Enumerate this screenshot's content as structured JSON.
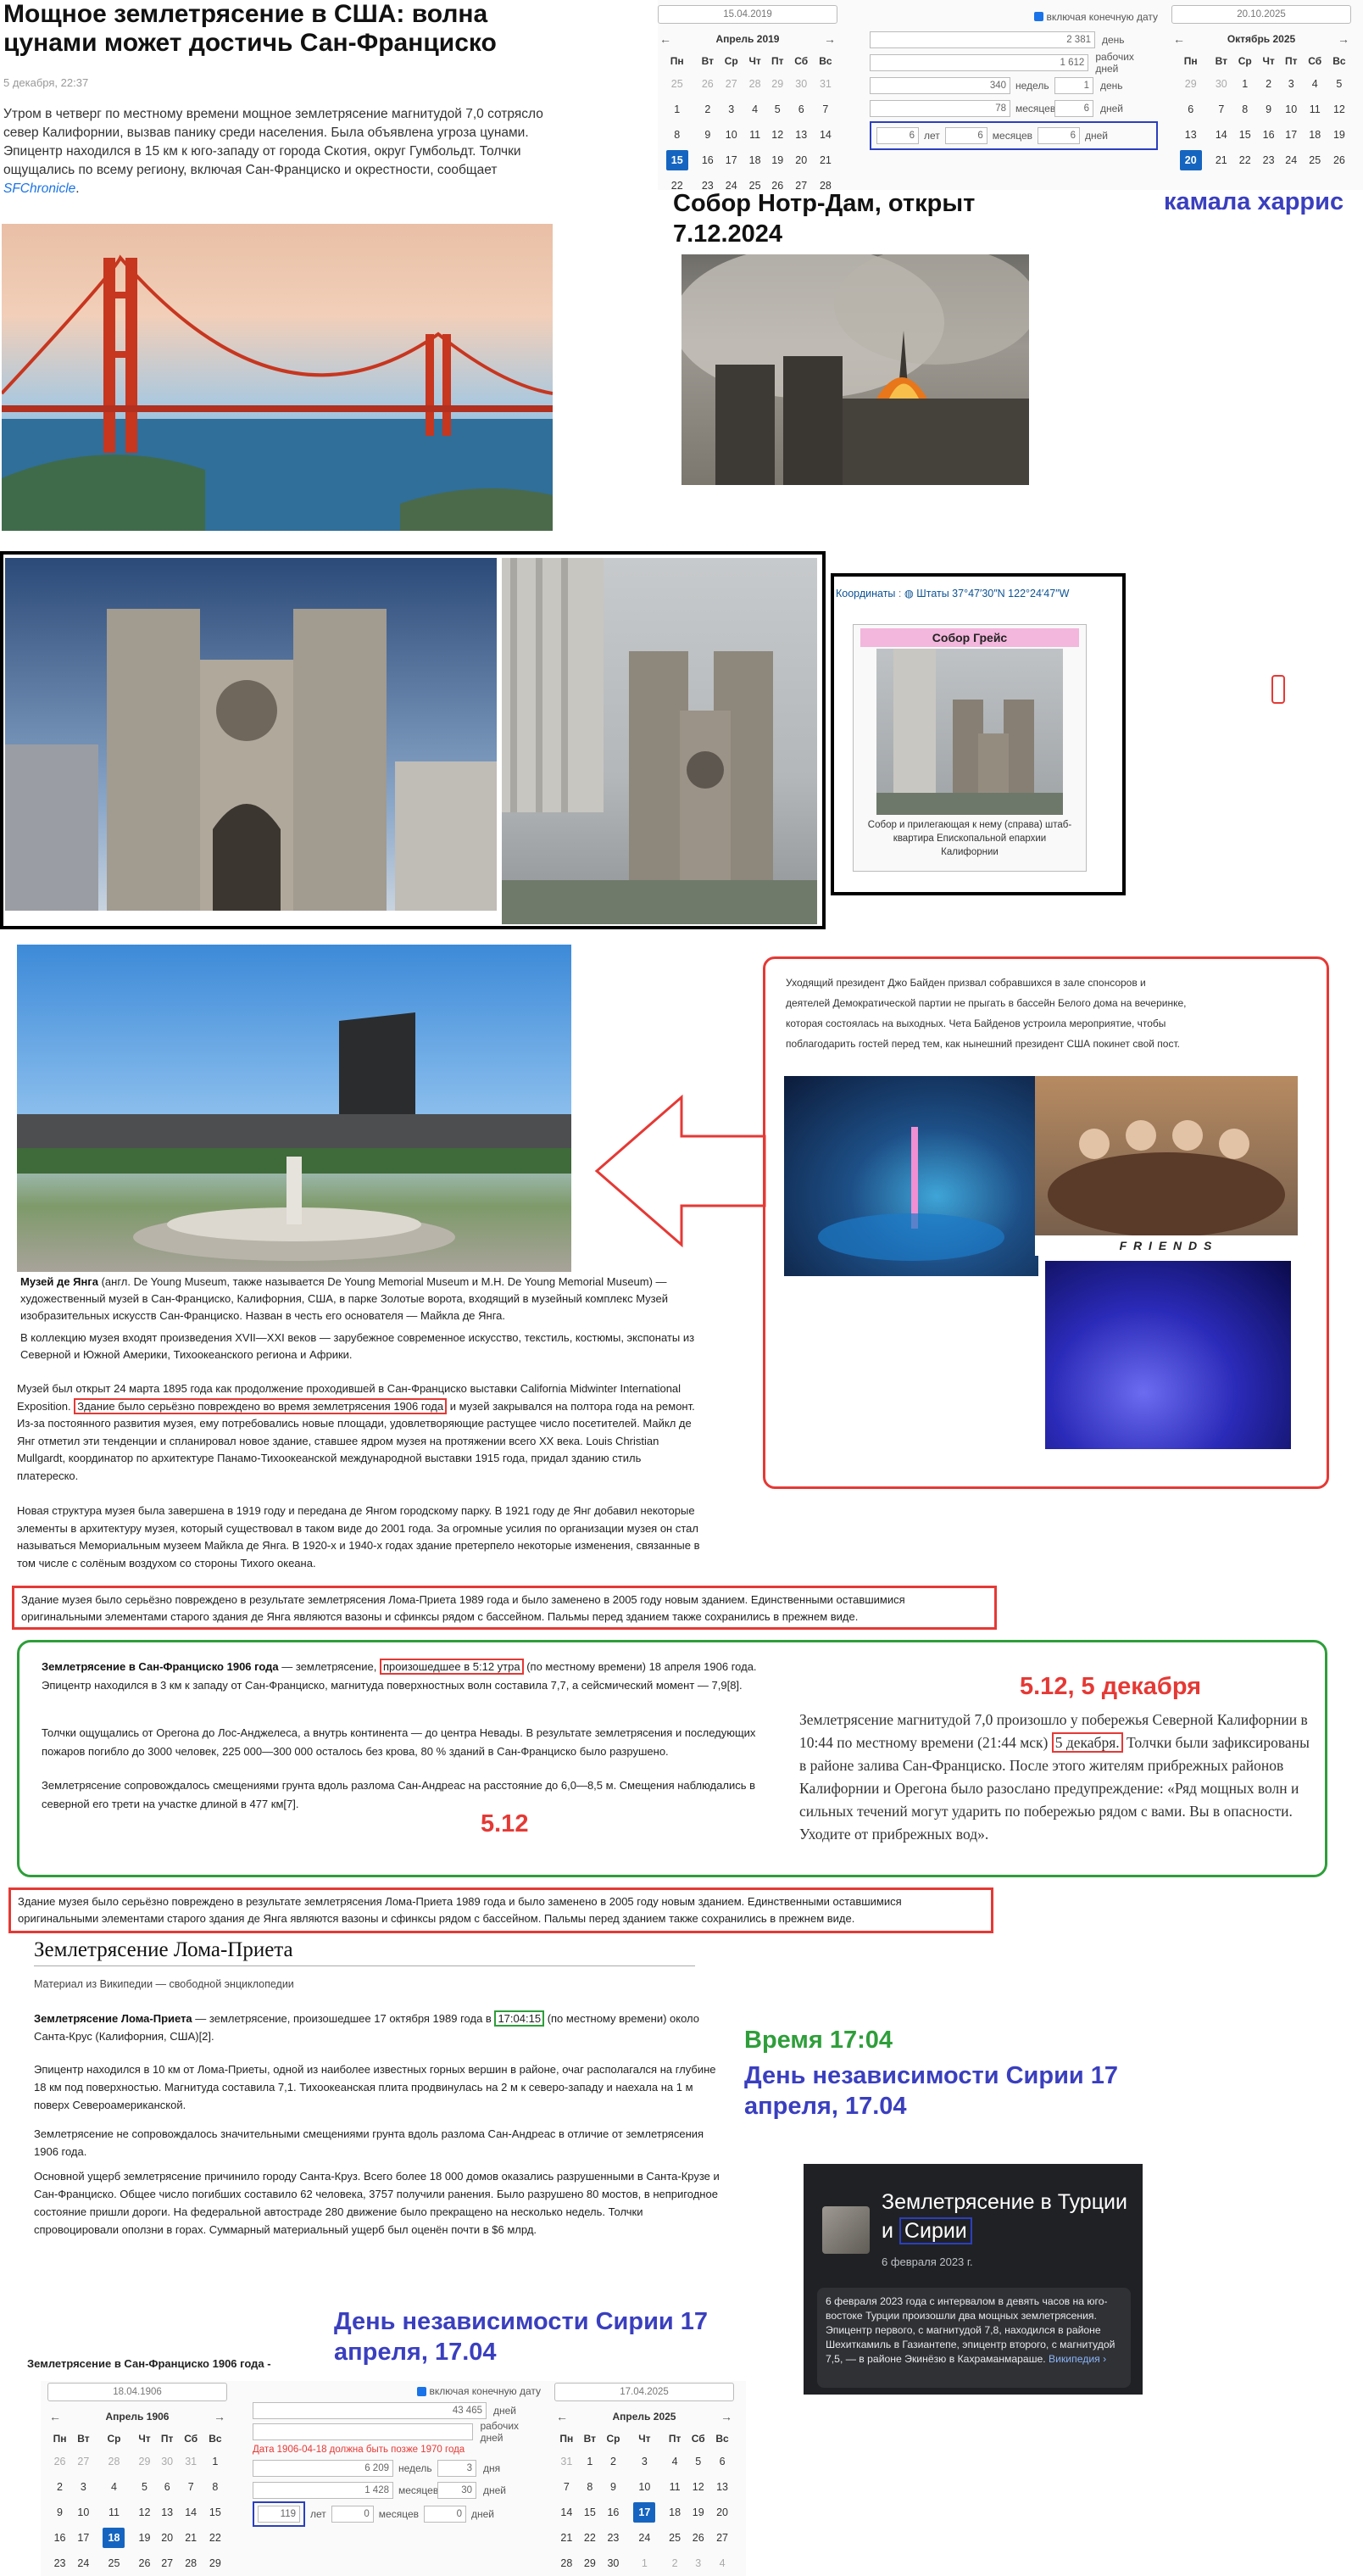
{
  "news": {
    "title": "Мощное землетрясение в США: волна цунами может достичь Сан-Франциско",
    "date": "5 декабря, 22:37",
    "body": "Утром в четверг по местному времени мощное землетрясение магнитудой 7,0 сотрясло север Калифорнии, вызвав панику среди населения. Была объявлена угроза цунами. Эпицентр находился в 15 км к юго-западу от города Скотия, округ Гумбольдт. Толчки ощущались по всему региону, включая Сан-Франциско и окрестности, сообщает",
    "source": "SFChronicle",
    "tail": "."
  },
  "calc_top": {
    "start_date": "15.04.2019",
    "end_date": "20.10.2025",
    "include_end": "включая конечную дату",
    "left_month": "Апрель 2019",
    "right_month": "Октябрь 2025",
    "weekdays": [
      "Пн",
      "Вт",
      "Ср",
      "Чт",
      "Пт",
      "Сб",
      "Вс"
    ],
    "left_rows": [
      [
        "25",
        "26",
        "27",
        "28",
        "29",
        "30",
        "31"
      ],
      [
        "1",
        "2",
        "3",
        "4",
        "5",
        "6",
        "7"
      ],
      [
        "8",
        "9",
        "10",
        "11",
        "12",
        "13",
        "14"
      ],
      [
        "15",
        "16",
        "17",
        "18",
        "19",
        "20",
        "21"
      ],
      [
        "22",
        "23",
        "24",
        "25",
        "26",
        "27",
        "28"
      ]
    ],
    "right_rows": [
      [
        "29",
        "30",
        "1",
        "2",
        "3",
        "4",
        "5"
      ],
      [
        "6",
        "7",
        "8",
        "9",
        "10",
        "11",
        "12"
      ],
      [
        "13",
        "14",
        "15",
        "16",
        "17",
        "18",
        "19"
      ],
      [
        "20",
        "21",
        "22",
        "23",
        "24",
        "25",
        "26"
      ]
    ],
    "days_val": "2 381",
    "days_lbl": "день",
    "work_val": "1 612",
    "work_lbl": "рабочих дней",
    "weeks_val": "340",
    "weeks_lbl": "недель",
    "weeks_rem": "1",
    "weeks_rem_lbl": "день",
    "months_val": "78",
    "months_lbl": "месяцев",
    "months_rem": "6",
    "months_rem_lbl": "дней",
    "y": "6",
    "y_lbl": "лет",
    "m": "6",
    "m_lbl": "месяцев",
    "d": "6",
    "d_lbl": "дней"
  },
  "captions": {
    "notre_dame": "Собор Нотр-Дам, открыт 7.12.2024",
    "harris": "камала харрис",
    "grace_coords_label": "Координаты",
    "grace_coords": "Штаты 37°47′30″N 122°24′47″W",
    "grace_title": "Собор Грейс",
    "grace_caption": "Собор и прилегающая к нему (справа) штаб-квартира Епископальной епархии Калифорнии",
    "biden": "Уходящий президент Джо Байден призвал собравшихся в зале спонсоров и деятелей Демократической партии не прыгать в бассейн Белого дома на вечеринке, которая состоялась на выходных. Чета Байденов устроила мероприятие, чтобы поблагодарить гостей перед тем, как нынешний президент США покинет свой пост.",
    "friends": "F R I E N D S",
    "five_twelve_dec": "5.12, 5 декабря",
    "five_twelve": "5.12",
    "time_1704": "Время 17:04",
    "syria_day": "День независимости Сирии 17 апреля, 17.04",
    "syria_day2": "День независимости Сирии 17 апреля, 17.04"
  },
  "museum": {
    "intro_b": "Музей де Янга",
    "intro": "(англ. De Young Museum, также называется De Young Memorial Museum и M.H. De Young Memorial Museum) — художественный музей в Сан-Франциско, Калифорния, США, в парке Золотые ворота, входящий в музейный комплекс Музей изобразительных искусств Сан-Франциско. Назван в честь его основателя — Майкла де Янга.",
    "collection": "В коллекцию музея входят произведения XVII—XXI веков — зарубежное современное искусство, текстиль, костюмы, экспонаты из Северной и Южной Америки, Тихоокеанского региона и Африки.",
    "p1a": "Музей был открыт 24 марта 1895 года как продолжение проходившей в Сан-Франциско выставки California Midwinter International Exposition.",
    "p1_boxed": "Здание было серьёзно повреждено во время землетрясения 1906 года",
    "p1b": "и музей закрывался на полтора года на ремонт. Из-за постоянного развития музея, ему потребовались новые площади, удовлетворяющие растущее число посетителей. Майкл де Янг отметил эти тенденции и спланировал новое здание, ставшее ядром музея на протяжении всего XX века. Louis Christian Mullgardt, координатор по архитектуре Панамо-Тихоокеанской международной выставки 1915 года, придал зданию стиль платереско.",
    "p2": "Новая структура музея была завершена в 1919 году и передана де Янгом городскому парку. В 1921 году де Янг добавил некоторые элементы в архитектуру музея, который существовал в таком виде до 2001 года. За огромные усилия по организации музея он стал называться Мемориальным музеем Майкла де Янга. В 1920-х и 1940-х годах здание претерпело некоторые изменения, связанные в том числе с солёным воздухом со стороны Тихого океана.",
    "p3": "Здание музея было серьёзно повреждено в результате землетрясения Лома-Приета 1989 года и было заменено в 2005 году новым зданием. Единственными оставшимися оригинальными элементами старого здания де Янга являются вазоны и сфинксы рядом с бассейном. Пальмы перед зданием также сохранились в прежнем виде."
  },
  "quake1906": {
    "title_b": "Землетрясение в Сан-Франциско 1906 года",
    "p1a": "— землетрясение,",
    "p1_boxed": "произошедшее в 5:12 утра",
    "p1b": "(по местному времени) 18 апреля 1906 года. Эпицентр находился в 3 км к западу от Сан-Франциско, магнитуда поверхностных волн составила 7,7, а сейсмический момент — 7,9[8].",
    "p2": "Толчки ощущались от Орегона до Лос-Анджелеса, а внутрь континента — до центра Невады. В результате землетрясения и последующих пожаров погибло до 3000 человек, 225 000—300 000 осталось без крова, 80 % зданий в Сан-Франциско было разрушено.",
    "p3": "Землетрясение сопровождалось смещениями грунта вдоль разлома Сан-Андреас на расстояние до 6,0—8,5 м. Смещения наблюдались в северной его трети на участке длиной в 477 км[7].",
    "right_a": "Землетрясение магнитудой 7,0 произошло у побережья Северной Калифорнии в 10:44 по местному времени (21:44 мск)",
    "right_boxed": "5 декабря.",
    "right_b": "Толчки были зафиксированы в районе залива Сан-Франциско. После этого жителям прибрежных районов Калифорнии и Орегона было разослано предупреждение: «Ряд мощных волн и сильных течений могут ударить по побережью рядом с вами. Вы в опасности. Уходите от прибрежных вод»."
  },
  "loma": {
    "heading": "Землетрясение Лома-Приета",
    "sub": "Материал из Википедии — свободной энциклопедии",
    "p1a_b": "Землетрясение Лома-Приета",
    "p1a": "— землетрясение, произошедшее 17 октября 1989 года в",
    "p1_boxed": "17:04:15",
    "p1b": "(по местному времени) около Санта-Крус (Калифорния, США)[2].",
    "p2": "Эпицентр находился в 10 км от Лома-Приеты, одной из наиболее известных горных вершин в районе, очаг располагался на глубине 18 км под поверхностью. Магнитуда составила 7,1. Тихоокеанская плита продвинулась на 2 м к северо-западу и наехала на 1 м поверх Североамериканской.",
    "p3": "Землетрясение не сопровождалось значительными смещениями грунта вдоль разлома Сан-Андреас в отличие от землетрясения 1906 года.",
    "p4": "Основной ущерб землетрясение причинило городу Санта-Круз. Всего более 18 000 домов оказались разрушенными в Санта-Крузе и Сан-Франциско. Общее число погибших составило 62 человека, 3757 получили ранения. Было разрушено 80 мостов, в непригодное состояние пришли дороги. На федеральной автострадe 280 движение было прекращено на несколько недель. Толчки спровоцировали оползни в горах. Суммарный материальный ущерб был оценён почти в $6 млрд."
  },
  "turkey": {
    "title_a": "Землетрясение в Турции и",
    "title_boxed": "Сирии",
    "date": "6 февраля 2023 г.",
    "body": "6 февраля 2023 года с интервалом в девять часов на юго-востоке Турции произошли два мощных землетрясения. Эпицентр первого, с магнитудой 7,8, находился в районе Шехиткамиль в Газиантепе, эпицентр второго, с магнитудой 7,5, — в районе Экинёзю в Кахраманмараше.",
    "link": "Википедия ›"
  },
  "calc_bottom": {
    "label": "Землетрясение в Сан-Франциско 1906 года -",
    "start_date": "18.04.1906",
    "end_date": "17.04.2025",
    "include_end": "включая конечную дату",
    "left_month": "Апрель 1906",
    "right_month": "Апрель 2025",
    "weekdays": [
      "Пн",
      "Вт",
      "Ср",
      "Чт",
      "Пт",
      "Сб",
      "Вс"
    ],
    "left_rows": [
      [
        "26",
        "27",
        "28",
        "29",
        "30",
        "31",
        "1"
      ],
      [
        "2",
        "3",
        "4",
        "5",
        "6",
        "7",
        "8"
      ],
      [
        "9",
        "10",
        "11",
        "12",
        "13",
        "14",
        "15"
      ],
      [
        "16",
        "17",
        "18",
        "19",
        "20",
        "21",
        "22"
      ],
      [
        "23",
        "24",
        "25",
        "26",
        "27",
        "28",
        "29"
      ]
    ],
    "right_rows": [
      [
        "31",
        "1",
        "2",
        "3",
        "4",
        "5",
        "6"
      ],
      [
        "7",
        "8",
        "9",
        "10",
        "11",
        "12",
        "13"
      ],
      [
        "14",
        "15",
        "16",
        "17",
        "18",
        "19",
        "20"
      ],
      [
        "21",
        "22",
        "23",
        "24",
        "25",
        "26",
        "27"
      ],
      [
        "28",
        "29",
        "30",
        "1",
        "2",
        "3",
        "4"
      ]
    ],
    "days_val": "43 465",
    "days_lbl": "дней",
    "work_lbl": "рабочих дней",
    "error": "Дата 1906-04-18 должна быть позже 1970 года",
    "weeks_val": "6 209",
    "weeks_lbl": "недель",
    "weeks_rem": "3",
    "weeks_rem_lbl": "дня",
    "months_val": "1 428",
    "months_lbl": "месяцев",
    "months_rem": "30",
    "months_rem_lbl": "дней",
    "y": "119",
    "y_lbl": "лет",
    "m": "0",
    "m_lbl": "месяцев",
    "d": "0",
    "d_lbl": "дней"
  }
}
